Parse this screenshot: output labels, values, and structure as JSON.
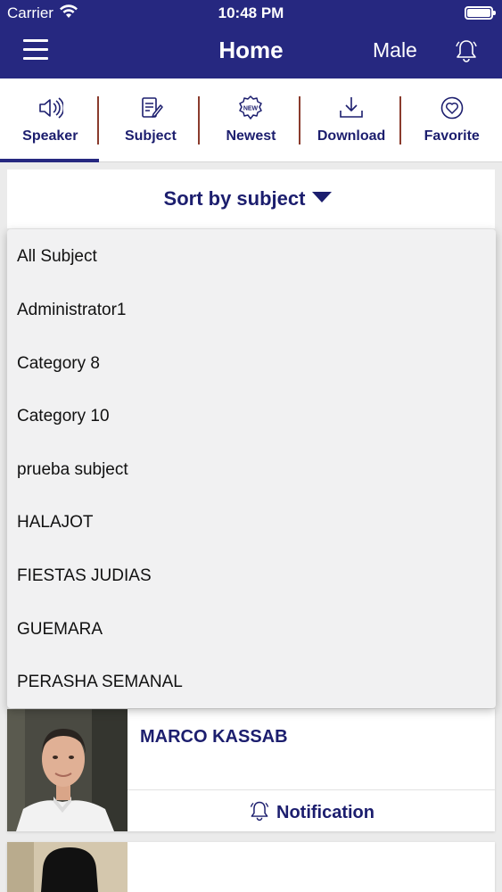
{
  "status_bar": {
    "carrier": "Carrier",
    "time": "10:48 PM"
  },
  "header": {
    "title": "Home",
    "gender": "Male",
    "menu_icon": "hamburger-icon",
    "bell_icon": "bell-icon"
  },
  "tabs": [
    {
      "label": "Speaker",
      "icon": "speaker-icon",
      "active": true
    },
    {
      "label": "Subject",
      "icon": "subject-icon",
      "active": false
    },
    {
      "label": "Newest",
      "icon": "new-badge-icon",
      "active": false
    },
    {
      "label": "Download",
      "icon": "download-icon",
      "active": false
    },
    {
      "label": "Favorite",
      "icon": "heart-icon",
      "active": false
    }
  ],
  "sort": {
    "label": "Sort by subject"
  },
  "dropdown": {
    "items": [
      "All Subject",
      "Administrator1",
      "Category 8",
      "Category 10",
      "prueba subject",
      "HALAJOT",
      "FIESTAS JUDIAS",
      "GUEMARA",
      "PERASHA SEMANAL"
    ]
  },
  "cards": [
    {
      "name": "MARCO KASSAB",
      "notification_label": "Notification"
    },
    {
      "name": "",
      "notification_label": ""
    }
  ],
  "colors": {
    "primary": "#262880",
    "text_dark": "#1c1e6e",
    "divider": "#8a3b2d"
  }
}
